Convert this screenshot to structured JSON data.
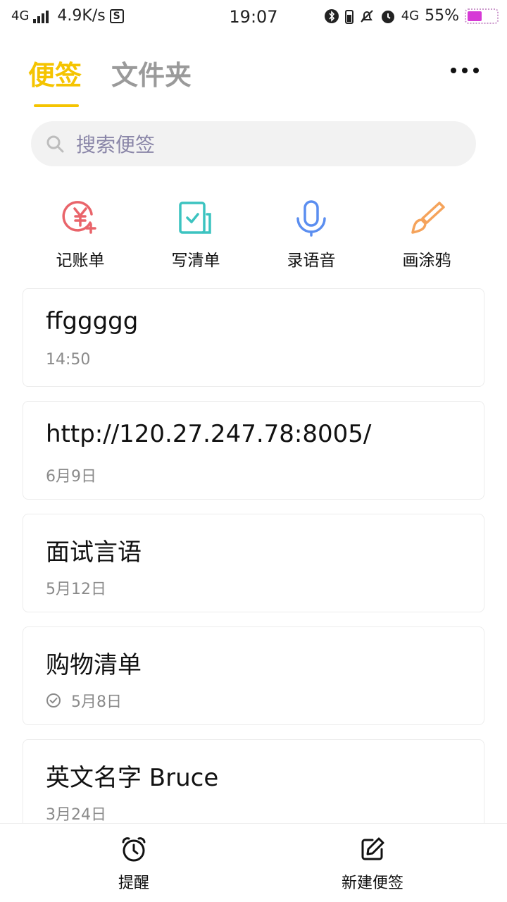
{
  "status_bar": {
    "network": "4G",
    "speed": "4.9K/s",
    "s_badge": "S",
    "time": "19:07",
    "network_right": "4G",
    "battery": "55%"
  },
  "tabs": [
    {
      "label": "便签"
    },
    {
      "label": "文件夹"
    }
  ],
  "search": {
    "placeholder": "搜索便签"
  },
  "quick_actions": [
    {
      "label": "记账单",
      "icon": "yuan-add-icon",
      "color": "#e9646a"
    },
    {
      "label": "写清单",
      "icon": "checklist-icon",
      "color": "#3cc3c0"
    },
    {
      "label": "录语音",
      "icon": "microphone-icon",
      "color": "#5b8ef0"
    },
    {
      "label": "画涂鸦",
      "icon": "brush-icon",
      "color": "#f5a35b"
    }
  ],
  "notes": [
    {
      "title": "ffggggg",
      "date": "14:50"
    },
    {
      "title": "http://120.27.247.78:8005/",
      "date": "6月9日"
    },
    {
      "title": "面试言语",
      "date": "5月12日"
    },
    {
      "title": "购物清单",
      "date": "5月8日",
      "checked": true
    },
    {
      "title": "英文名字 Bruce",
      "date": "3月24日"
    }
  ],
  "bottom_bar": {
    "reminder_label": "提醒",
    "new_note_label": "新建便签"
  }
}
